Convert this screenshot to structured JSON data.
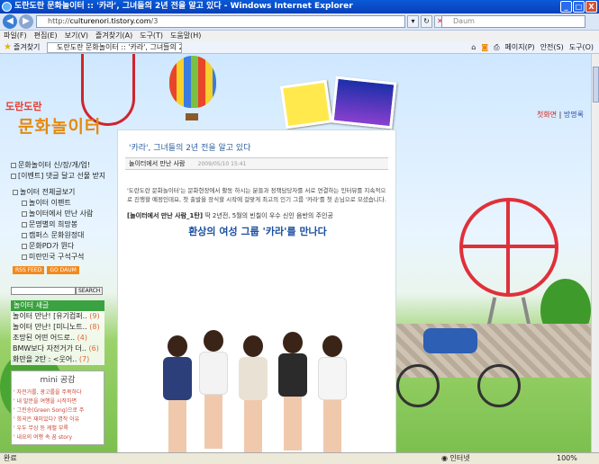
{
  "window": {
    "title": "도란도란 문화놀이터 :: '카라', 그녀들의 2년 전을 알고 있다 - Windows Internet Explorer",
    "controls": [
      "_",
      "□",
      "X"
    ]
  },
  "address": {
    "url_prefix": "http://",
    "url_host": "culturenori.tistory.com",
    "url_path": "/3",
    "search_placeholder": "Daum"
  },
  "menu": [
    "파일(F)",
    "편집(E)",
    "보기(V)",
    "즐겨찾기(A)",
    "도구(T)",
    "도움말(H)"
  ],
  "favbar": {
    "favorites_label": "즐겨찾기",
    "tab_title": "도란도란 문화놀이터 :: '카라', 그녀들의 2년 전...",
    "tools": [
      "페이지(P)",
      "안전(S)",
      "도구(O)"
    ]
  },
  "blog": {
    "logo_top": "도란도란",
    "logo_main": "문화놀이터",
    "nav_first": "첫화면",
    "nav_sep": "|",
    "nav_guestbook": "방명록",
    "notices": [
      "문화놀이터 신/장/개/업!",
      "[이벤트] 댓글 달고 선물 받자!"
    ],
    "categories": [
      "놀이터 전체글보기",
      "놀이터 이펜트",
      "놀이터에서 만난 사람",
      "문명별의 희망봉",
      "캠퍼스 문화원정대",
      "문화PD가 뛴다",
      "미란민국 구석구석"
    ],
    "rss_buttons": [
      "RSS FEED",
      "GO DAUM"
    ],
    "search_button": "SEARCH",
    "recent_head": "놀이터 새글",
    "recent_posts": [
      {
        "title": "놀이터 만난! [유기컴퍼..",
        "count": "(9)"
      },
      {
        "title": "놀이터 만난! [미니노트..",
        "count": "(8)"
      },
      {
        "title": "조망된 어떤 어드로..",
        "count": "(4)"
      },
      {
        "title": "BMW보다 자전거가 더..",
        "count": "(6)"
      },
      {
        "title": "화만을 2탄 : <웃어..",
        "count": "(7)"
      }
    ],
    "mini_head": "mini 공감",
    "mini_items": [
      "' 자전거를, 광고를을 주목하다",
      "' 내 발문을 여행을 시작하면",
      "' 그린송(Green Song)으로 주",
      "' 희곡은 재미있다? 명작 이유",
      "' 우두 무상 등 케밸 부록",
      "' 내요의 여행 속 꿈 story"
    ],
    "post": {
      "title": "'카라', 그녀들의 2년 전을 알고 있다",
      "category": "놀이터에서 만난 사람",
      "date": "2009/05/10 15:41",
      "body1": "'도란도란 문화놀이터'는 문화현장에서 활동 하시는 분들과 정책담당자를 서로 연결하는 인터뷰를 지속적으로 진행할 예정인데요, 첫 출발을 장식할 시작에 걸맞게 최고의 인기 그룹 '카라'를 첫 손님으로 모셨습니다.",
      "body2_bold": "[놀이터에서 만난 사람_1탄]",
      "body2_rest": " 딱 2년전, 5월의 빈칠이 우수 신인 음반의 주인공",
      "headline": "환상의 여성 그룹 '카라'를 만나다"
    }
  },
  "status": {
    "left": "완료",
    "zone": "인터넷",
    "zoom": "100%"
  }
}
